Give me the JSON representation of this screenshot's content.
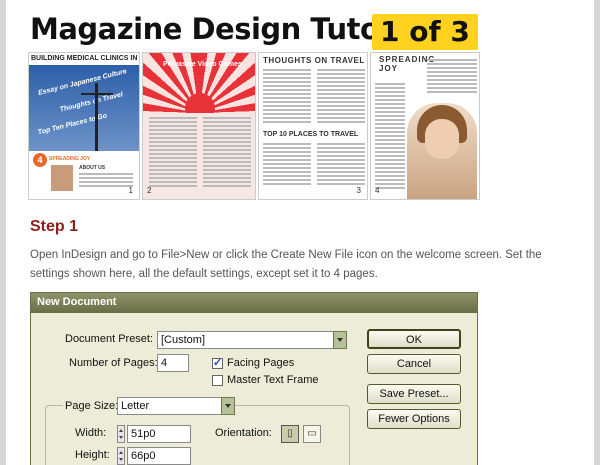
{
  "header": {
    "title": "Magazine Design Tutorial:",
    "badge": "1 of 3"
  },
  "spreads": {
    "page1": {
      "title": "BUILDING MEDICAL CLINICS IN ASIA ISSUE",
      "cover_line_1": "Essay on Japanese Culture",
      "cover_line_2": "Thoughts on Travel",
      "cover_line_3": "Top Ten Places to Go",
      "badge_number": "4",
      "badge_text": "SPREADING JOY",
      "about": "ABOUT US",
      "page_number": "1"
    },
    "page2": {
      "heading": "Pervasive Video Games",
      "page_number": "2"
    },
    "page3": {
      "heading": "THOUGHTS ON TRAVEL",
      "subheading": "TOP 10 PLACES TO TRAVEL",
      "page_number": "3"
    },
    "page4": {
      "heading": "SPREADING JOY",
      "page_number": "4"
    }
  },
  "step": {
    "title": "Step 1",
    "body": "Open InDesign and go to File>New or click the Create New File icon on the welcome screen. Set the settings shown here, all the default settings, except set it to 4 pages."
  },
  "dialog": {
    "title": "New Document",
    "preset_label": "Document Preset:",
    "preset_value": "[Custom]",
    "pages_label": "Number of Pages:",
    "pages_value": "4",
    "facing_pages_label": "Facing Pages",
    "facing_pages_checked": true,
    "master_text_label": "Master Text Frame",
    "master_text_checked": false,
    "page_size_label": "Page Size:",
    "page_size_value": "Letter",
    "width_label": "Width:",
    "width_value": "51p0",
    "height_label": "Height:",
    "height_value": "66p0",
    "orientation_label": "Orientation:",
    "ok_label": "OK",
    "cancel_label": "Cancel",
    "save_preset_label": "Save Preset...",
    "fewer_options_label": "Fewer Options"
  },
  "colors": {
    "step_title": "#8b2020",
    "badge_bg": "#ffd21f",
    "dialog_titlebar": "#686d45"
  }
}
